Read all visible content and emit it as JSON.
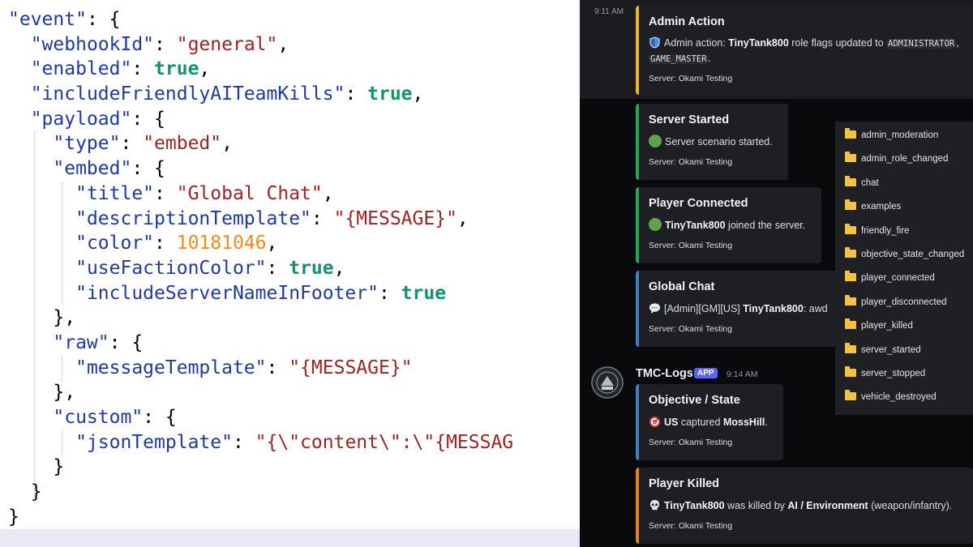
{
  "editor": {
    "lines": [
      [
        {
          "t": "k",
          "v": "\"event\""
        },
        {
          "t": "p",
          "v": ": {"
        }
      ],
      [
        {
          "t": "p",
          "v": "  "
        },
        {
          "t": "k",
          "v": "\"webhookId\""
        },
        {
          "t": "p",
          "v": ": "
        },
        {
          "t": "s",
          "v": "\"general\""
        },
        {
          "t": "p",
          "v": ","
        }
      ],
      [
        {
          "t": "p",
          "v": "  "
        },
        {
          "t": "k",
          "v": "\"enabled\""
        },
        {
          "t": "p",
          "v": ": "
        },
        {
          "t": "b",
          "v": "true"
        },
        {
          "t": "p",
          "v": ","
        }
      ],
      [
        {
          "t": "p",
          "v": "  "
        },
        {
          "t": "k",
          "v": "\"includeFriendlyAITeamKills\""
        },
        {
          "t": "p",
          "v": ": "
        },
        {
          "t": "b",
          "v": "true"
        },
        {
          "t": "p",
          "v": ","
        }
      ],
      [
        {
          "t": "p",
          "v": "  "
        },
        {
          "t": "k",
          "v": "\"payload\""
        },
        {
          "t": "p",
          "v": ": {"
        }
      ],
      [
        {
          "t": "p",
          "v": "    "
        },
        {
          "t": "k",
          "v": "\"type\""
        },
        {
          "t": "p",
          "v": ": "
        },
        {
          "t": "s",
          "v": "\"embed\""
        },
        {
          "t": "p",
          "v": ","
        }
      ],
      [
        {
          "t": "p",
          "v": "    "
        },
        {
          "t": "k",
          "v": "\"embed\""
        },
        {
          "t": "p",
          "v": ": {"
        }
      ],
      [
        {
          "t": "p",
          "v": "      "
        },
        {
          "t": "k",
          "v": "\"title\""
        },
        {
          "t": "p",
          "v": ": "
        },
        {
          "t": "s",
          "v": "\"Global Chat\""
        },
        {
          "t": "p",
          "v": ","
        }
      ],
      [
        {
          "t": "p",
          "v": "      "
        },
        {
          "t": "k",
          "v": "\"descriptionTemplate\""
        },
        {
          "t": "p",
          "v": ": "
        },
        {
          "t": "s",
          "v": "\"{MESSAGE}\""
        },
        {
          "t": "p",
          "v": ","
        }
      ],
      [
        {
          "t": "p",
          "v": "      "
        },
        {
          "t": "k",
          "v": "\"color\""
        },
        {
          "t": "p",
          "v": ": "
        },
        {
          "t": "n",
          "v": "10181046"
        },
        {
          "t": "p",
          "v": ","
        }
      ],
      [
        {
          "t": "p",
          "v": "      "
        },
        {
          "t": "k",
          "v": "\"useFactionColor\""
        },
        {
          "t": "p",
          "v": ": "
        },
        {
          "t": "b",
          "v": "true"
        },
        {
          "t": "p",
          "v": ","
        }
      ],
      [
        {
          "t": "p",
          "v": "      "
        },
        {
          "t": "k",
          "v": "\"includeServerNameInFooter\""
        },
        {
          "t": "p",
          "v": ": "
        },
        {
          "t": "b",
          "v": "true"
        }
      ],
      [
        {
          "t": "p",
          "v": "    },"
        }
      ],
      [
        {
          "t": "p",
          "v": "    "
        },
        {
          "t": "k",
          "v": "\"raw\""
        },
        {
          "t": "p",
          "v": ": {"
        }
      ],
      [
        {
          "t": "p",
          "v": "      "
        },
        {
          "t": "k",
          "v": "\"messageTemplate\""
        },
        {
          "t": "p",
          "v": ": "
        },
        {
          "t": "s",
          "v": "\"{MESSAGE}\""
        }
      ],
      [
        {
          "t": "p",
          "v": "    },"
        }
      ],
      [
        {
          "t": "p",
          "v": "    "
        },
        {
          "t": "k",
          "v": "\"custom\""
        },
        {
          "t": "p",
          "v": ": {"
        }
      ],
      [
        {
          "t": "p",
          "v": "      "
        },
        {
          "t": "k",
          "v": "\"jsonTemplate\""
        },
        {
          "t": "p",
          "v": ": "
        },
        {
          "t": "s",
          "v": "\"{\\\"content\\\":\\\"{MESSAG"
        }
      ],
      [
        {
          "t": "p",
          "v": "    }"
        }
      ],
      [
        {
          "t": "p",
          "v": "  }"
        }
      ],
      [
        {
          "t": "p",
          "v": "}"
        }
      ]
    ]
  },
  "chat": {
    "first_time": "9:11 AM",
    "embeds": [
      {
        "id": "admin-action",
        "title": "Admin Action",
        "icon": "shield-icon",
        "color": "#f0b232",
        "desc_pre": "Admin action: ",
        "desc_bold": "TinyTank800",
        "desc_mid": " role flags updated to ",
        "code1": "ADMINISTRATOR",
        "code1_suffix": ",",
        "code2": "GAME_MASTER",
        "code2_suffix": ".",
        "footer": "Server: Okami Testing"
      },
      {
        "id": "server-started",
        "title": "Server Started",
        "icon": "green-circle-icon",
        "color": "#23a55a",
        "desc": "Server scenario started.",
        "footer": "Server: Okami Testing"
      },
      {
        "id": "player-connected",
        "title": "Player Connected",
        "icon": "green-circle-icon",
        "color": "#23a55a",
        "desc_bold": "TinyTank800",
        "desc_post": " joined the server.",
        "footer": "Server: Okami Testing"
      },
      {
        "id": "global-chat",
        "title": "Global Chat",
        "icon": "speech-bubble-icon",
        "color": "#3b82c4",
        "desc_pre": "[Admin][GM][US] ",
        "desc_bold": "TinyTank800",
        "desc_post": ": awd",
        "footer": "Server: Okami Testing"
      },
      {
        "id": "objective-state",
        "title": "Objective / State",
        "icon": "target-icon",
        "color": "#3b82c4",
        "desc_bold": "US",
        "desc_mid": " captured ",
        "desc_bold2": "MossHill",
        "desc_post": ".",
        "footer": "Server: Okami Testing"
      },
      {
        "id": "player-killed",
        "title": "Player Killed",
        "icon": "skull-icon",
        "color": "#e67e22",
        "desc_bold": "TinyTank800",
        "desc_mid": " was killed by ",
        "desc_bold2": "AI / Environment",
        "desc_post": " (weapon/infantry).",
        "footer": "Server: Okami Testing"
      }
    ],
    "bot": {
      "name": "TMC-Logs",
      "badge": "APP",
      "time": "9:14 AM"
    },
    "folders": [
      "admin_moderation",
      "admin_role_changed",
      "chat",
      "examples",
      "friendly_fire",
      "objective_state_changed",
      "player_connected",
      "player_disconnected",
      "player_killed",
      "server_started",
      "server_stopped",
      "vehicle_destroyed"
    ]
  }
}
